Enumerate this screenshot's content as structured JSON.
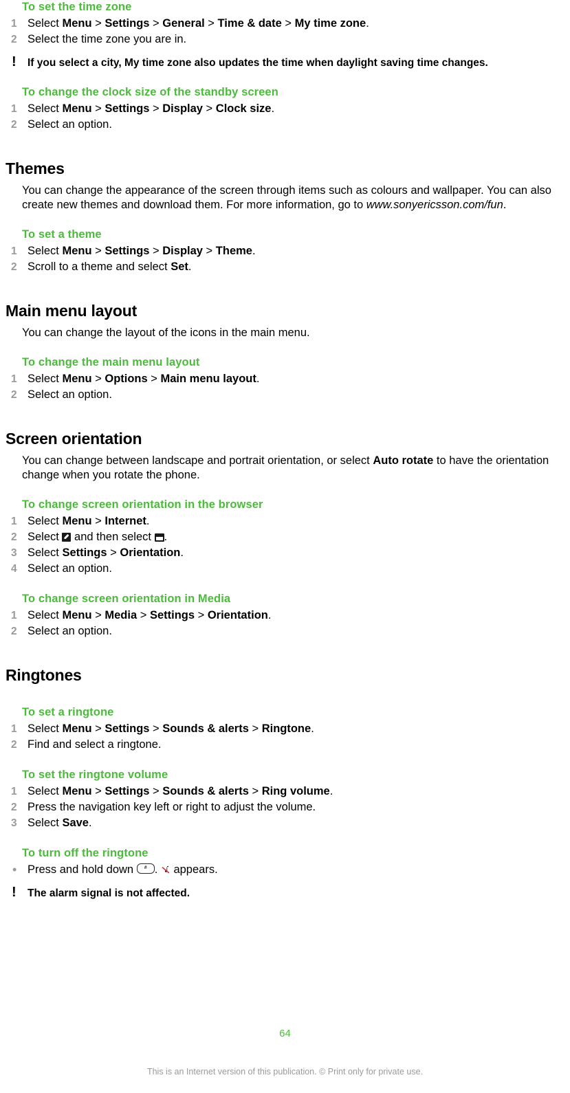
{
  "document": {
    "page_number": "64",
    "footer_note": "This is an Internet version of this publication. © Print only for private use.",
    "accent_green": "#4CBB3C",
    "step_number_gray": "#9a9a9a"
  },
  "blocks": {
    "time_zone": {
      "title": "To set the time zone",
      "steps": [
        {
          "num": "1",
          "parts": [
            {
              "t": "Select ",
              "s": "n"
            },
            {
              "t": "Menu",
              "s": "b"
            },
            {
              "t": " > ",
              "s": "n"
            },
            {
              "t": "Settings",
              "s": "b"
            },
            {
              "t": " > ",
              "s": "n"
            },
            {
              "t": "General",
              "s": "b"
            },
            {
              "t": " > ",
              "s": "n"
            },
            {
              "t": "Time & date",
              "s": "b"
            },
            {
              "t": " > ",
              "s": "n"
            },
            {
              "t": "My time zone",
              "s": "b"
            },
            {
              "t": ".",
              "s": "n"
            }
          ]
        },
        {
          "num": "2",
          "parts": [
            {
              "t": "Select the time zone you are in.",
              "s": "n"
            }
          ]
        }
      ]
    },
    "time_zone_note": {
      "icon": "exclamation-note-icon",
      "parts": [
        {
          "t": "If you select a city, ",
          "s": "n"
        },
        {
          "t": "My time zone",
          "s": "b"
        },
        {
          "t": " also updates the time when daylight saving time changes.",
          "s": "n"
        }
      ]
    },
    "clock_size": {
      "title": "To change the clock size of the standby screen",
      "steps": [
        {
          "num": "1",
          "parts": [
            {
              "t": "Select ",
              "s": "n"
            },
            {
              "t": "Menu",
              "s": "b"
            },
            {
              "t": " > ",
              "s": "n"
            },
            {
              "t": "Settings",
              "s": "b"
            },
            {
              "t": " > ",
              "s": "n"
            },
            {
              "t": "Display",
              "s": "b"
            },
            {
              "t": " > ",
              "s": "n"
            },
            {
              "t": "Clock size",
              "s": "b"
            },
            {
              "t": ".",
              "s": "n"
            }
          ]
        },
        {
          "num": "2",
          "parts": [
            {
              "t": "Select an option.",
              "s": "n"
            }
          ]
        }
      ]
    },
    "themes": {
      "heading": "Themes",
      "paragraph_parts": [
        {
          "t": "You can change the appearance of the screen through items such as colours and wallpaper. You can also create new themes and download them. For more information, go to ",
          "s": "n"
        },
        {
          "t": "www.sonyericsson.com/fun",
          "s": "i"
        },
        {
          "t": ".",
          "s": "n"
        }
      ]
    },
    "set_theme": {
      "title": "To set a theme",
      "steps": [
        {
          "num": "1",
          "parts": [
            {
              "t": "Select ",
              "s": "n"
            },
            {
              "t": "Menu",
              "s": "b"
            },
            {
              "t": " > ",
              "s": "n"
            },
            {
              "t": "Settings",
              "s": "b"
            },
            {
              "t": " > ",
              "s": "n"
            },
            {
              "t": "Display",
              "s": "b"
            },
            {
              "t": " > ",
              "s": "n"
            },
            {
              "t": "Theme",
              "s": "b"
            },
            {
              "t": ".",
              "s": "n"
            }
          ]
        },
        {
          "num": "2",
          "parts": [
            {
              "t": "Scroll to a theme and select ",
              "s": "n"
            },
            {
              "t": "Set",
              "s": "b"
            },
            {
              "t": ".",
              "s": "n"
            }
          ]
        }
      ]
    },
    "main_menu_layout": {
      "heading": "Main menu layout",
      "paragraph_parts": [
        {
          "t": "You can change the layout of the icons in the main menu.",
          "s": "n"
        }
      ]
    },
    "change_main_menu": {
      "title": "To change the main menu layout",
      "steps": [
        {
          "num": "1",
          "parts": [
            {
              "t": "Select ",
              "s": "n"
            },
            {
              "t": "Menu",
              "s": "b"
            },
            {
              "t": " > ",
              "s": "n"
            },
            {
              "t": "Options",
              "s": "b"
            },
            {
              "t": " > ",
              "s": "n"
            },
            {
              "t": "Main menu layout",
              "s": "b"
            },
            {
              "t": ".",
              "s": "n"
            }
          ]
        },
        {
          "num": "2",
          "parts": [
            {
              "t": "Select an option.",
              "s": "n"
            }
          ]
        }
      ]
    },
    "screen_orientation": {
      "heading": "Screen orientation",
      "paragraph_parts": [
        {
          "t": "You can change between landscape and portrait orientation, or select ",
          "s": "n"
        },
        {
          "t": "Auto rotate",
          "s": "b"
        },
        {
          "t": " to have the orientation change when you rotate the phone.",
          "s": "n"
        }
      ]
    },
    "orientation_browser": {
      "title": "To change screen orientation in the browser",
      "steps": [
        {
          "num": "1",
          "parts": [
            {
              "t": "Select ",
              "s": "n"
            },
            {
              "t": "Menu",
              "s": "b"
            },
            {
              "t": " > ",
              "s": "n"
            },
            {
              "t": "Internet",
              "s": "b"
            },
            {
              "t": ".",
              "s": "n"
            }
          ]
        },
        {
          "num": "2",
          "parts": [
            {
              "t": "Select ",
              "s": "n"
            },
            {
              "t": "",
              "s": "icon-pen"
            },
            {
              "t": " and then select ",
              "s": "n"
            },
            {
              "t": "",
              "s": "icon-view"
            },
            {
              "t": ".",
              "s": "n"
            }
          ]
        },
        {
          "num": "3",
          "parts": [
            {
              "t": "Select ",
              "s": "n"
            },
            {
              "t": "Settings",
              "s": "b"
            },
            {
              "t": " > ",
              "s": "n"
            },
            {
              "t": "Orientation",
              "s": "b"
            },
            {
              "t": ".",
              "s": "n"
            }
          ]
        },
        {
          "num": "4",
          "parts": [
            {
              "t": "Select an option.",
              "s": "n"
            }
          ]
        }
      ]
    },
    "orientation_media": {
      "title": "To change screen orientation in Media",
      "steps": [
        {
          "num": "1",
          "parts": [
            {
              "t": "Select ",
              "s": "n"
            },
            {
              "t": "Menu",
              "s": "b"
            },
            {
              "t": " > ",
              "s": "n"
            },
            {
              "t": "Media",
              "s": "b"
            },
            {
              "t": " > ",
              "s": "n"
            },
            {
              "t": "Settings",
              "s": "b"
            },
            {
              "t": " > ",
              "s": "n"
            },
            {
              "t": "Orientation",
              "s": "b"
            },
            {
              "t": ".",
              "s": "n"
            }
          ]
        },
        {
          "num": "2",
          "parts": [
            {
              "t": "Select an option.",
              "s": "n"
            }
          ]
        }
      ]
    },
    "ringtones": {
      "heading": "Ringtones"
    },
    "set_ringtone": {
      "title": "To set a ringtone",
      "steps": [
        {
          "num": "1",
          "parts": [
            {
              "t": "Select ",
              "s": "n"
            },
            {
              "t": "Menu",
              "s": "b"
            },
            {
              "t": " > ",
              "s": "n"
            },
            {
              "t": "Settings",
              "s": "b"
            },
            {
              "t": " > ",
              "s": "n"
            },
            {
              "t": "Sounds & alerts",
              "s": "b"
            },
            {
              "t": " > ",
              "s": "n"
            },
            {
              "t": "Ringtone",
              "s": "b"
            },
            {
              "t": ".",
              "s": "n"
            }
          ]
        },
        {
          "num": "2",
          "parts": [
            {
              "t": "Find and select a ringtone.",
              "s": "n"
            }
          ]
        }
      ]
    },
    "ringtone_volume": {
      "title": "To set the ringtone volume",
      "steps": [
        {
          "num": "1",
          "parts": [
            {
              "t": "Select ",
              "s": "n"
            },
            {
              "t": "Menu",
              "s": "b"
            },
            {
              "t": " > ",
              "s": "n"
            },
            {
              "t": "Settings",
              "s": "b"
            },
            {
              "t": " > ",
              "s": "n"
            },
            {
              "t": "Sounds & alerts",
              "s": "b"
            },
            {
              "t": " > ",
              "s": "n"
            },
            {
              "t": "Ring volume",
              "s": "b"
            },
            {
              "t": ".",
              "s": "n"
            }
          ]
        },
        {
          "num": "2",
          "parts": [
            {
              "t": "Press the navigation key left or right to adjust the volume.",
              "s": "n"
            }
          ]
        },
        {
          "num": "3",
          "parts": [
            {
              "t": "Select ",
              "s": "n"
            },
            {
              "t": "Save",
              "s": "b"
            },
            {
              "t": ".",
              "s": "n"
            }
          ]
        }
      ]
    },
    "turn_off_ringtone": {
      "title": "To turn off the ringtone",
      "steps": [
        {
          "num": "•",
          "parts": [
            {
              "t": "Press and hold down ",
              "s": "n"
            },
            {
              "t": "#",
              "s": "icon-hashkey"
            },
            {
              "t": ". ",
              "s": "n"
            },
            {
              "t": "",
              "s": "icon-mute"
            },
            {
              "t": " appears.",
              "s": "n"
            }
          ]
        }
      ]
    },
    "alarm_note": {
      "icon": "exclamation-note-icon",
      "parts": [
        {
          "t": "The alarm signal is not affected.",
          "s": "n"
        }
      ]
    }
  }
}
